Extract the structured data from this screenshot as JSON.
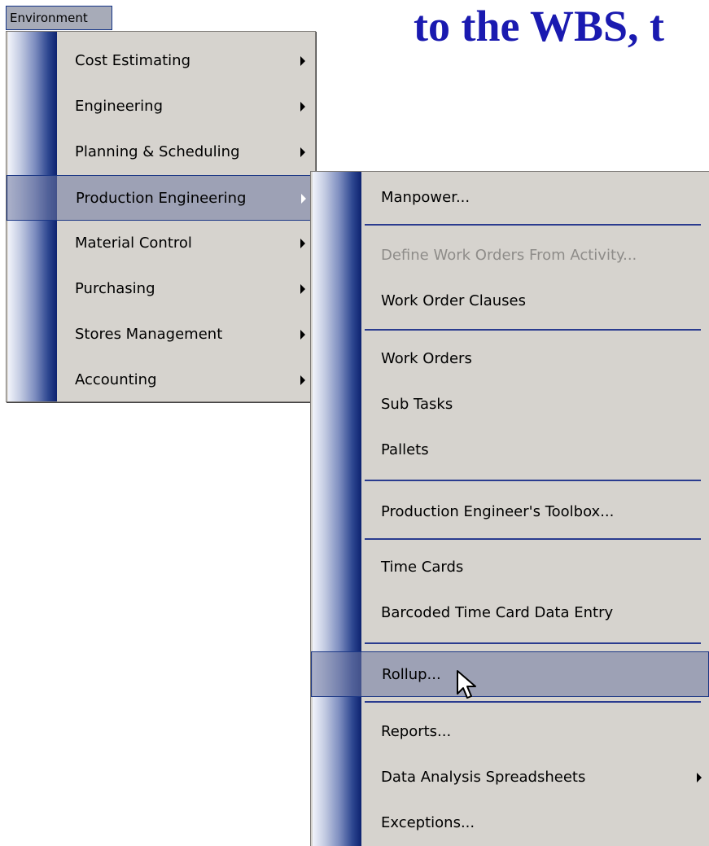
{
  "slide": {
    "title": "to the WBS, t"
  },
  "menubar": {
    "active_label": "Environment"
  },
  "environment_menu": {
    "items": [
      {
        "label": "Cost Estimating"
      },
      {
        "label": "Engineering"
      },
      {
        "label": "Planning & Scheduling"
      },
      {
        "label": "Production Engineering"
      },
      {
        "label": "Material Control"
      },
      {
        "label": "Purchasing"
      },
      {
        "label": "Stores Management"
      },
      {
        "label": "Accounting"
      }
    ],
    "highlighted": "Production Engineering"
  },
  "production_engineering_menu": {
    "items": [
      {
        "label": "Manpower..."
      },
      {
        "label": "Define Work Orders From Activity..."
      },
      {
        "label": "Work Order Clauses"
      },
      {
        "label": "Work Orders"
      },
      {
        "label": "Sub Tasks"
      },
      {
        "label": "Pallets"
      },
      {
        "label": "Production Engineer's Toolbox..."
      },
      {
        "label": "Time Cards"
      },
      {
        "label": "Barcoded Time Card Data Entry"
      },
      {
        "label": "Rollup..."
      },
      {
        "label": "Reports..."
      },
      {
        "label": "Data Analysis Spreadsheets"
      },
      {
        "label": "Exceptions..."
      }
    ],
    "disabled": "Define Work Orders From Activity...",
    "highlighted": "Rollup..."
  },
  "colors": {
    "title": "#1a1ab0",
    "menu_background": "#d6d3ce",
    "highlight_border": "#1b3785",
    "separator": "#2a3b8f"
  }
}
